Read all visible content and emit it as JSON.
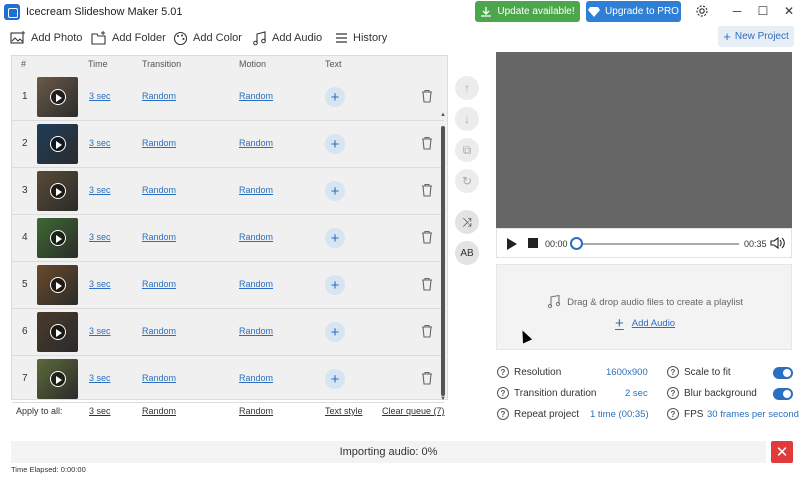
{
  "window": {
    "title": "Icecream Slideshow Maker 5.01",
    "update_label": "Update available!",
    "pro_label": "Upgrade to PRO"
  },
  "toolbar": {
    "add_photo": "Add Photo",
    "add_folder": "Add Folder",
    "add_color": "Add Color",
    "add_audio": "Add Audio",
    "history": "History",
    "new_project": "New Project"
  },
  "grid": {
    "columns": [
      "#",
      "Time",
      "Transition",
      "Motion",
      "Text"
    ],
    "rows": [
      {
        "num": "1",
        "time": "3 sec",
        "transition": "Random",
        "motion": "Random",
        "thumb_color": "#6b5a48"
      },
      {
        "num": "2",
        "time": "3 sec",
        "transition": "Random",
        "motion": "Random",
        "thumb_color": "#1f3d5a"
      },
      {
        "num": "3",
        "time": "3 sec",
        "transition": "Random",
        "motion": "Random",
        "thumb_color": "#5a4a36"
      },
      {
        "num": "4",
        "time": "3 sec",
        "transition": "Random",
        "motion": "Random",
        "thumb_color": "#3d6a32"
      },
      {
        "num": "5",
        "time": "3 sec",
        "transition": "Random",
        "motion": "Random",
        "thumb_color": "#6b4a2a"
      },
      {
        "num": "6",
        "time": "3 sec",
        "transition": "Random",
        "motion": "Random",
        "thumb_color": "#4a3a2a"
      },
      {
        "num": "7",
        "time": "3 sec",
        "transition": "Random",
        "motion": "Random",
        "thumb_color": "#5c6a3a"
      }
    ],
    "apply_label": "Apply to all:",
    "apply_time": "3 sec",
    "apply_transition": "Random",
    "apply_motion": "Random",
    "text_style": "Text style",
    "clear_queue": "Clear queue (7)"
  },
  "player": {
    "current_time": "00:00",
    "total_time": "00:35",
    "progress": 0
  },
  "audio": {
    "drop_text": "Drag & drop audio files to create a playlist",
    "add_audio_link": "Add Audio"
  },
  "settings": {
    "resolution_label": "Resolution",
    "resolution_value": "1600x900",
    "transition_label": "Transition duration",
    "transition_value": "2 sec",
    "repeat_label": "Repeat project",
    "repeat_value": "1 time (00:35)",
    "scale_label": "Scale to fit",
    "scale_on": true,
    "blur_label": "Blur background",
    "blur_on": true,
    "fps_label": "FPS",
    "fps_value": "30 frames per second"
  },
  "status": {
    "importing": "Importing audio: 0%",
    "elapsed": "Time Elapsed: 0:00:00"
  },
  "colors": {
    "accent": "#2a6fc0",
    "update_green": "#4ca64c",
    "close_red": "#e03a3a"
  }
}
